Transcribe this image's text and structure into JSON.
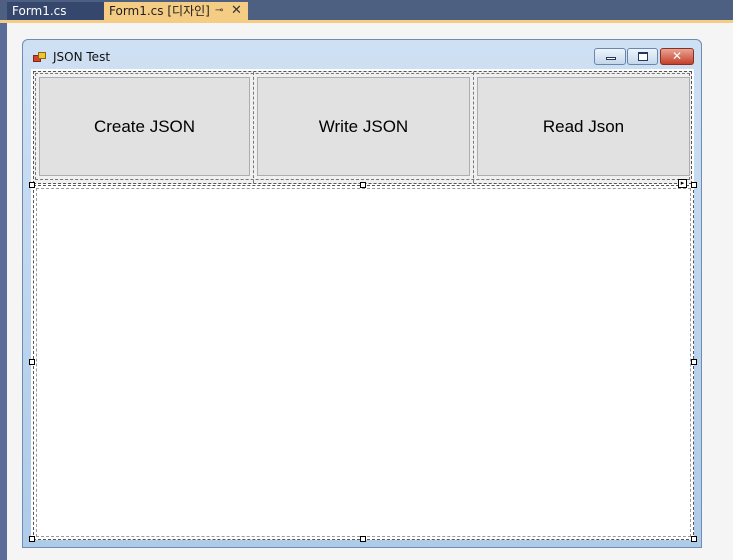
{
  "tabs": [
    {
      "label": "Form1.cs",
      "active": false
    },
    {
      "label": "Form1.cs [디자인]",
      "active": true
    }
  ],
  "icons": {
    "pin": "pin-icon",
    "close": "close-icon",
    "form": "form-icon"
  },
  "form": {
    "title": "JSON Test",
    "buttons": {
      "create": "Create JSON",
      "write": "Write JSON",
      "read": "Read Json"
    }
  },
  "colors": {
    "tab_active": "#f5cc84",
    "tab_inactive": "#36476d",
    "ide_frame": "#5a6a99",
    "button_face": "#e1e1e1"
  }
}
